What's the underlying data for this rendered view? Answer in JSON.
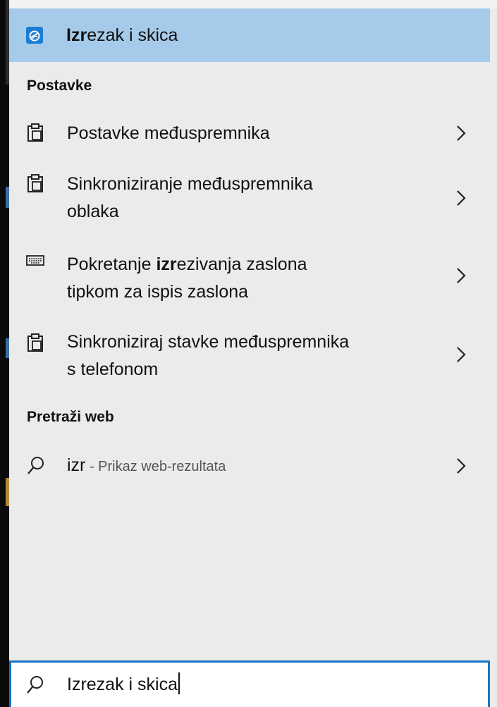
{
  "best_match": {
    "title_bold": "Izr",
    "title_rest": "ezak i skica",
    "icon": "snip-sketch-app-icon"
  },
  "settings_section": {
    "header": "Postavke",
    "items": [
      {
        "icon": "clipboard-icon",
        "line1": "Postavke međuspremnika",
        "line2": ""
      },
      {
        "icon": "clipboard-icon",
        "line1": "Sinkroniziranje međuspremnika",
        "line2": "oblaka"
      },
      {
        "icon": "keyboard-icon",
        "line1_pre": "Pokretanje ",
        "line1_bold": "izr",
        "line1_post": "ezivanja zaslona",
        "line2": "tipkom za ispis zaslona"
      },
      {
        "icon": "clipboard-icon",
        "line1": "Sinkroniziraj stavke međuspremnika",
        "line2": "s telefonom"
      }
    ]
  },
  "web_section": {
    "header": "Pretraži web",
    "query": "izr",
    "suffix": " - Prikaz web-rezultata"
  },
  "search": {
    "value": "Izrezak i skica"
  },
  "colors": {
    "panel_bg": "#ebebeb",
    "selected_bg": "#a6cbea",
    "accent": "#1a73c8"
  }
}
